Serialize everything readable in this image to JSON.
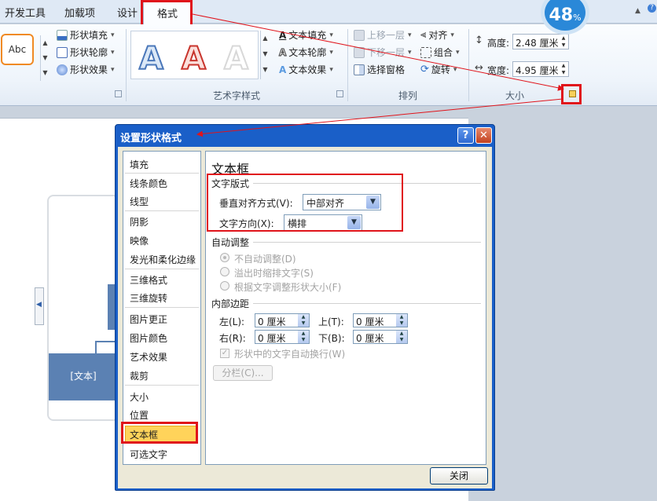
{
  "tabs": {
    "dev_tools": "开发工具",
    "addins": "加载项",
    "design": "设计",
    "format": "格式"
  },
  "badge": {
    "value": "48",
    "unit": "%"
  },
  "ribbon": {
    "shape_styles": {
      "preview_text": "Abc",
      "fill": "形状填充",
      "outline": "形状轮廓",
      "effects": "形状效果"
    },
    "wordart": {
      "letter": "A",
      "text_fill": "文本填充",
      "text_outline": "文本轮廓",
      "text_effects": "文本效果",
      "group_label": "艺术字样式"
    },
    "arrange": {
      "bring_forward": "上移一层",
      "send_backward": "下移一层",
      "selection_pane": "选择窗格",
      "align": "对齐",
      "group": "组合",
      "rotate": "旋转",
      "group_label": "排列"
    },
    "size": {
      "height_label": "高度:",
      "height_value": "2.48 厘米",
      "width_label": "宽度:",
      "width_value": "4.95 厘米",
      "group_label": "大小"
    }
  },
  "slide": {
    "block_text": "[文本]"
  },
  "dialog": {
    "title": "设置形状格式",
    "help": "?",
    "close_x": "✕",
    "nav": [
      "填充",
      "线条颜色",
      "线型",
      "阴影",
      "映像",
      "发光和柔化边缘",
      "三维格式",
      "三维旋转",
      "图片更正",
      "图片颜色",
      "艺术效果",
      "裁剪",
      "大小",
      "位置",
      "文本框",
      "可选文字"
    ],
    "panel": {
      "heading": "文本框",
      "text_layout": "文字版式",
      "vertical_align_label": "垂直对齐方式(V):",
      "vertical_align_value": "中部对齐",
      "text_direction_label": "文字方向(X):",
      "text_direction_value": "横排",
      "autofit": "自动调整",
      "autofit_none": "不自动调整(D)",
      "autofit_shrink": "溢出时缩排文字(S)",
      "autofit_resize": "根据文字调整形状大小(F)",
      "internal_margin": "内部边距",
      "left_label": "左(L):",
      "left_value": "0 厘米",
      "top_label": "上(T):",
      "top_value": "0 厘米",
      "right_label": "右(R):",
      "right_value": "0 厘米",
      "bottom_label": "下(B):",
      "bottom_value": "0 厘米",
      "wrap_text": "形状中的文字自动换行(W)",
      "columns_button": "分栏(C)..."
    },
    "close_button": "关闭"
  },
  "colors": {
    "annotation_red": "#e0141b",
    "dialog_blue": "#1a5fc8",
    "smartart_blue": "#5b81b3",
    "nav_active": "#ffd35a"
  }
}
